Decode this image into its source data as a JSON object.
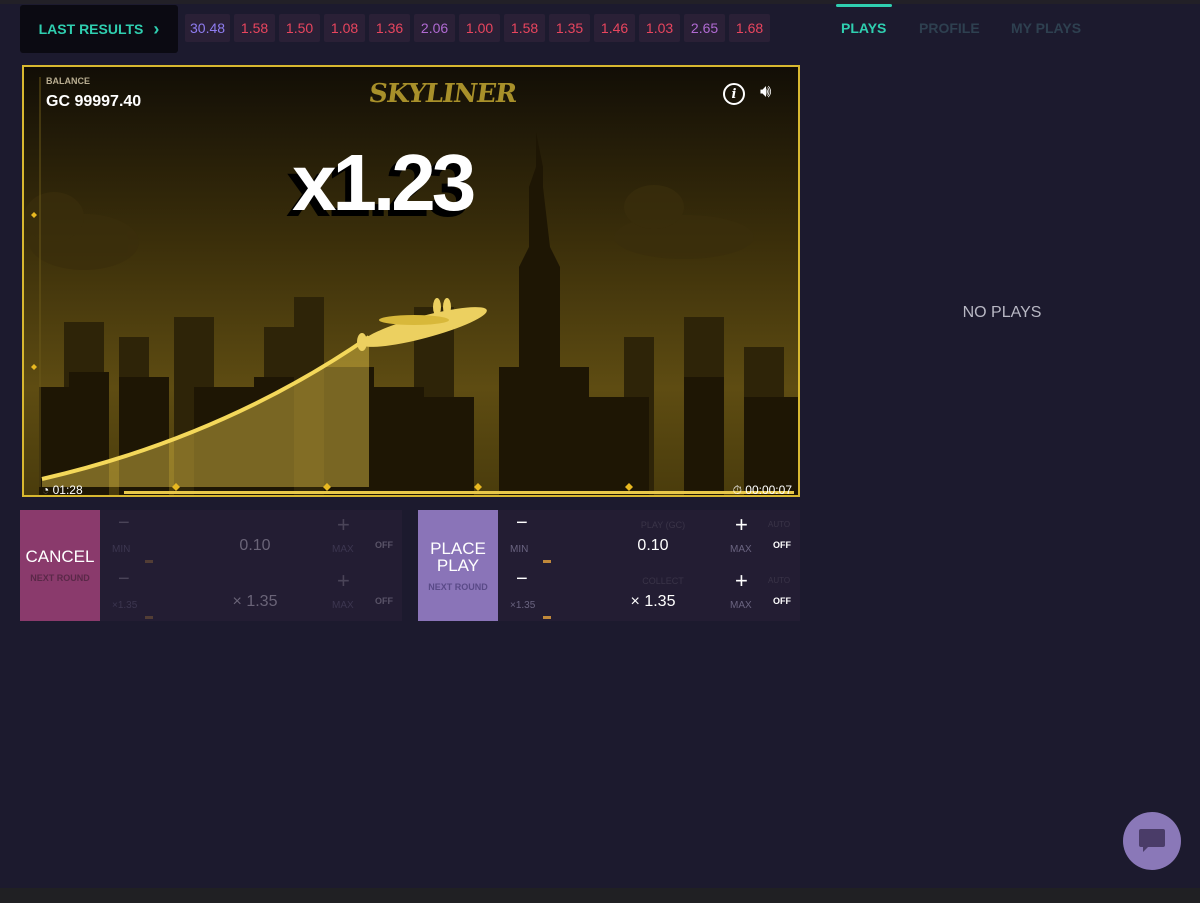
{
  "colors": {
    "accent": "#2fcfb0",
    "gold": "#d8b830",
    "cancel": "#8a3a6c",
    "place": "#8a74b8",
    "red": "#e8455e",
    "purple": "#8f7cf0",
    "violet": "#b06ad2"
  },
  "last_results": {
    "label": "LAST RESULTS",
    "icon": "chevron-right-icon",
    "items": [
      {
        "v": "30.48",
        "c": "#8f7cf0"
      },
      {
        "v": "1.58",
        "c": "#e8455e"
      },
      {
        "v": "1.50",
        "c": "#e8455e"
      },
      {
        "v": "1.08",
        "c": "#e8455e"
      },
      {
        "v": "1.36",
        "c": "#e8455e"
      },
      {
        "v": "2.06",
        "c": "#b06ad2"
      },
      {
        "v": "1.00",
        "c": "#e8455e"
      },
      {
        "v": "1.58",
        "c": "#e8455e"
      },
      {
        "v": "1.35",
        "c": "#e8455e"
      },
      {
        "v": "1.46",
        "c": "#e8455e"
      },
      {
        "v": "1.03",
        "c": "#e8455e"
      },
      {
        "v": "2.65",
        "c": "#b06ad2"
      },
      {
        "v": "1.68",
        "c": "#e8455e"
      }
    ]
  },
  "game": {
    "balance_label": "BALANCE",
    "balance": "GC 99997.40",
    "logo": "SKYLINER",
    "multiplier": "x1.23",
    "elapsed": "01:28",
    "timer": "00:00:07"
  },
  "controls": {
    "left": {
      "button": "CANCEL",
      "sub": "NEXT ROUND",
      "bet": {
        "minus": "−",
        "min": "MIN",
        "label": "",
        "value": "0.10",
        "plus": "+",
        "max": "MAX",
        "auto": "",
        "toggle": "OFF"
      },
      "collect": {
        "minus": "−",
        "min": "×1.35",
        "label": "",
        "value": "× 1.35",
        "plus": "+",
        "max": "MAX",
        "auto": "",
        "toggle": "OFF"
      }
    },
    "right": {
      "button": "PLACE PLAY",
      "sub": "NEXT ROUND",
      "bet": {
        "minus": "−",
        "min": "MIN",
        "label": "PLAY (GC)",
        "value": "0.10",
        "plus": "+",
        "max": "MAX",
        "auto": "AUTO",
        "toggle": "OFF"
      },
      "collect": {
        "minus": "−",
        "min": "×1.35",
        "label": "COLLECT",
        "value": "× 1.35",
        "plus": "+",
        "max": "MAX",
        "auto": "AUTO",
        "toggle": "OFF"
      }
    }
  },
  "sidebar": {
    "tabs": [
      {
        "label": "PLAYS",
        "active": true
      },
      {
        "label": "PROFILE",
        "active": false
      },
      {
        "label": "MY PLAYS",
        "active": false
      }
    ],
    "empty": "NO PLAYS"
  }
}
